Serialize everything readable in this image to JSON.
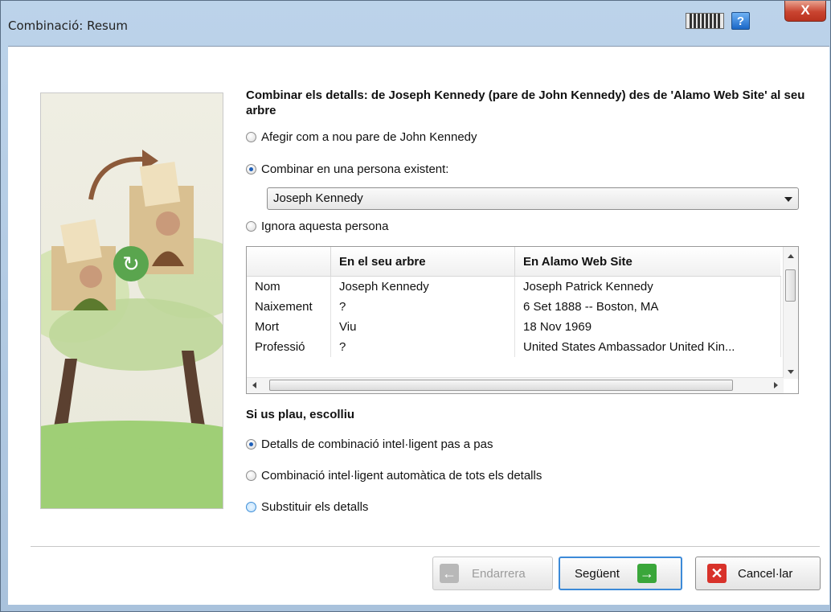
{
  "window": {
    "title": "Combinació: Resum",
    "keyboard_icon": "keyboard-icon",
    "help_label": "?",
    "close_label": "X"
  },
  "heading": "Combinar els detalls: de Joseph Kennedy (pare de John Kennedy) des de 'Alamo Web Site' al seu arbre",
  "options": {
    "add_new": "Afegir com a nou pare de John Kennedy",
    "merge_existing": "Combinar en una persona existent:",
    "ignore": "Ignora aquesta persona",
    "selected": "merge_existing"
  },
  "person_select": {
    "value": "Joseph Kennedy"
  },
  "compare_table": {
    "headers": [
      "",
      "En el seu arbre",
      "En Alamo Web Site"
    ],
    "rows": [
      [
        "Nom",
        "Joseph Kennedy",
        "Joseph Patrick Kennedy"
      ],
      [
        "Naixement",
        "?",
        "6 Set 1888 -- Boston, MA"
      ],
      [
        "Mort",
        "Viu",
        "18 Nov 1969"
      ],
      [
        "Professió",
        "?",
        "United States Ambassador United Kin..."
      ]
    ]
  },
  "choose": {
    "heading": "Si us plau, escolliu",
    "step_by_step": "Detalls de combinació intel·ligent pas a pas",
    "automatic": "Combinació intel·ligent automàtica de tots els detalls",
    "replace": "Substituir els detalls",
    "selected": "step_by_step"
  },
  "buttons": {
    "back": "Endarrera",
    "next": "Següent",
    "cancel": "Cancel·lar"
  },
  "colors": {
    "accent": "#3c8ad8",
    "next_arrow": "#3aa63a",
    "cancel_icon": "#d8322a"
  }
}
